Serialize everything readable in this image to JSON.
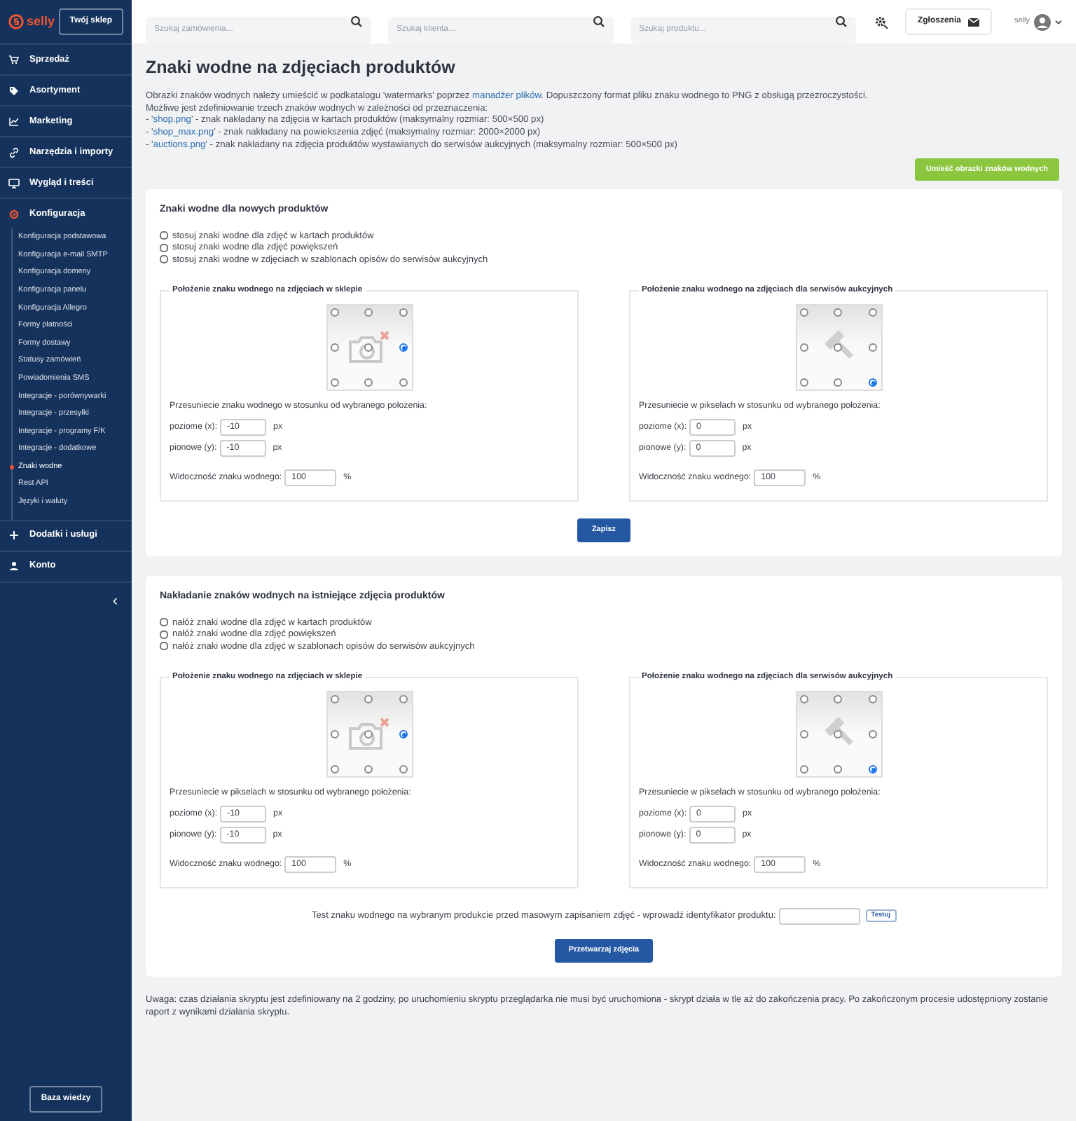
{
  "sidebar": {
    "logo": "selly",
    "shop_button": "Twój sklep",
    "items": [
      {
        "label": "Sprzedaż",
        "kind": "cart",
        "expanded": false
      },
      {
        "label": "Asortyment",
        "kind": "tag",
        "expanded": false
      },
      {
        "label": "Marketing",
        "kind": "chart",
        "expanded": false
      },
      {
        "label": "Narzędzia i importy",
        "kind": "link",
        "expanded": false
      },
      {
        "label": "Wygląd i treści",
        "kind": "monitor",
        "expanded": false
      },
      {
        "label": "Konfiguracja",
        "kind": "gear",
        "expanded": true,
        "children": [
          {
            "label": "Konfiguracja podstawowa",
            "selected": false
          },
          {
            "label": "Konfiguracja e-mail SMTP",
            "selected": false
          },
          {
            "label": "Konfiguracja domeny",
            "selected": false
          },
          {
            "label": "Konfiguracja panelu",
            "selected": false
          },
          {
            "label": "Konfiguracja Allegro",
            "selected": false
          },
          {
            "label": "Formy płatności",
            "selected": false
          },
          {
            "label": "Formy dostawy",
            "selected": false
          },
          {
            "label": "Statusy zamówień",
            "selected": false
          },
          {
            "label": "Powiadomienia SMS",
            "selected": false
          },
          {
            "label": "Integracje - porównywarki",
            "selected": false
          },
          {
            "label": "Integracje - przesyłki",
            "selected": false
          },
          {
            "label": "Integracje - programy F/K",
            "selected": false
          },
          {
            "label": "Integracje - dodatkowe",
            "selected": false
          },
          {
            "label": "Znaki wodne",
            "selected": true
          },
          {
            "label": "Rest API",
            "selected": false
          },
          {
            "label": "Języki i waluty",
            "selected": false
          }
        ]
      },
      {
        "label": "Dodatki i usługi",
        "kind": "plus",
        "expanded": false
      },
      {
        "label": "Konto",
        "kind": "user",
        "expanded": false
      }
    ],
    "collapse": "‹",
    "help_button": "Baza wiedzy"
  },
  "topbar": {
    "searches": [
      {
        "placeholder": "Szukaj zamówienia..."
      },
      {
        "placeholder": "Szukaj klienta..."
      },
      {
        "placeholder": "Szukaj produktu..."
      }
    ],
    "tickets_button": "Zgłoszenia",
    "user": "selly"
  },
  "title": "Znaki wodne na zdjęciach produktów",
  "intro": [
    [
      {
        "text": "Obrazki znaków wodnych należy umieścić w podkatalogu 'watermarks' poprzez "
      },
      {
        "text": "manadżer plików",
        "link": true
      },
      {
        "text": ". Dopuszczony format pliku znaku wodnego to PNG z obsługą przezroczystości."
      }
    ],
    [
      {
        "text": "Możliwe jest zdefiniowanie trzech znaków wodnych w zależności od przeznaczenia:"
      }
    ],
    [
      {
        "text": "- '"
      },
      {
        "text": "shop.png",
        "link": true
      },
      {
        "text": "' - znak nakładany na zdjęcia w kartach produktów (maksymalny rozmiar: 500×500 px)"
      }
    ],
    [
      {
        "text": "- '"
      },
      {
        "text": "shop_max.png",
        "link": true
      },
      {
        "text": "' - znak nakładany na powiekszenia zdjęć (maksymalny rozmiar: 2000×2000 px)"
      }
    ],
    [
      {
        "text": "- '"
      },
      {
        "text": "auctions.png",
        "link": true
      },
      {
        "text": "' - znak nakładany na zdjęcia produktów wystawianych do serwisów aukcyjnych (maksymalny rozmiar: 500×500 px)"
      }
    ]
  ],
  "upload_button": "Umieść obrazki znaków wodnych",
  "sections": [
    {
      "title": "Znaki wodne dla nowych produktów",
      "checkboxes": [
        {
          "label": "stosuj znaki wodne dla zdjęć w kartach produktów",
          "checked": false
        },
        {
          "label": "stosuj znaki wodne dla zdjęć powiększeń",
          "checked": false
        },
        {
          "label": "stosuj znaki wodne w zdjęciach w szablonach opisów do serwisów aukcyjnych",
          "checked": false
        }
      ],
      "panels": [
        {
          "title": "Położenie znaku wodnego na zdjęciach w sklepie",
          "kind": "camera",
          "positions": [
            {
              "selected": false
            },
            {
              "selected": false
            },
            {
              "selected": false
            },
            {
              "selected": false
            },
            {
              "selected": false
            },
            {
              "selected": true
            },
            {
              "selected": false
            },
            {
              "selected": false
            },
            {
              "selected": false
            }
          ],
          "offset_label": "Przesuniecie znaku wodnego w stosunku od wybranego położenia:",
          "x_label": "poziome (x):",
          "x_value": "-10",
          "x_unit": "px",
          "y_label": "pionowe (y):",
          "y_value": "-10",
          "y_unit": "px",
          "visibility_label": "Widoczność znaku wodnego:",
          "visibility_value": "100",
          "visibility_unit": "%"
        },
        {
          "title": "Położenie znaku wodnego na zdjęciach dla serwisów aukcyjnych",
          "kind": "gavel",
          "positions": [
            {
              "selected": false
            },
            {
              "selected": false
            },
            {
              "selected": false
            },
            {
              "selected": false
            },
            {
              "selected": false
            },
            {
              "selected": false
            },
            {
              "selected": false
            },
            {
              "selected": false
            },
            {
              "selected": true
            }
          ],
          "offset_label": "Przesuniecie w pikselach w stosunku od wybranego położenia:",
          "x_label": "poziome (x):",
          "x_value": "0",
          "x_unit": "px",
          "y_label": "pionowe (y):",
          "y_value": "0",
          "y_unit": "px",
          "visibility_label": "Widoczność znaku wodnego:",
          "visibility_value": "100",
          "visibility_unit": "%"
        }
      ],
      "button": "Zapisz"
    },
    {
      "title": "Nakładanie znaków wodnych na istniejące zdjęcia produktów",
      "checkboxes": [
        {
          "label": "nałóż znaki wodne dla zdjęć w kartach produktów",
          "checked": false
        },
        {
          "label": "nałóż znaki wodne dla zdjęć powiększeń",
          "checked": false
        },
        {
          "label": "nałóż znaki wodne dla zdjęć w szablonach opisów do serwisów aukcyjnych",
          "checked": false
        }
      ],
      "panels": [
        {
          "title": "Położenie znaku wodnego na zdjęciach w sklepie",
          "kind": "camera",
          "positions": [
            {
              "selected": false
            },
            {
              "selected": false
            },
            {
              "selected": false
            },
            {
              "selected": false
            },
            {
              "selected": false
            },
            {
              "selected": true
            },
            {
              "selected": false
            },
            {
              "selected": false
            },
            {
              "selected": false
            }
          ],
          "offset_label": "Przesuniecie w pikselach w stosunku od wybranego położenia:",
          "x_label": "poziome (x):",
          "x_value": "-10",
          "x_unit": "px",
          "y_label": "pionowe (y):",
          "y_value": "-10",
          "y_unit": "px",
          "visibility_label": "Widoczność znaku wodnego:",
          "visibility_value": "100",
          "visibility_unit": "%"
        },
        {
          "title": "Położenie znaku wodnego na zdjęciach dla serwisów aukcyjnych",
          "kind": "gavel",
          "positions": [
            {
              "selected": false
            },
            {
              "selected": false
            },
            {
              "selected": false
            },
            {
              "selected": false
            },
            {
              "selected": false
            },
            {
              "selected": false
            },
            {
              "selected": false
            },
            {
              "selected": false
            },
            {
              "selected": true
            }
          ],
          "offset_label": "Przesuniecie w pikselach w stosunku od wybranego położenia:",
          "x_label": "poziome (x):",
          "x_value": "0",
          "x_unit": "px",
          "y_label": "pionowe (y):",
          "y_value": "0",
          "y_unit": "px",
          "visibility_label": "Widoczność znaku wodnego:",
          "visibility_value": "100",
          "visibility_unit": "%"
        }
      ],
      "test": {
        "label": "Test znaku wodnego na wybranym produkcie przed masowym zapisaniem zdjęć - wprowadź identyfikator produktu:",
        "button": "Testuj"
      },
      "button": "Przetwarzaj zdjęcia"
    }
  ],
  "note": "Uwaga: czas działania skryptu jest zdefiniowany na 2 godziny, po uruchomieniu skryptu przeglądarka nie musi być uruchomiona - skrypt działa w tle aż do zakończenia pracy. Po zakończonym procesie udostępniony zostanie raport z wynikami działania skryptu."
}
